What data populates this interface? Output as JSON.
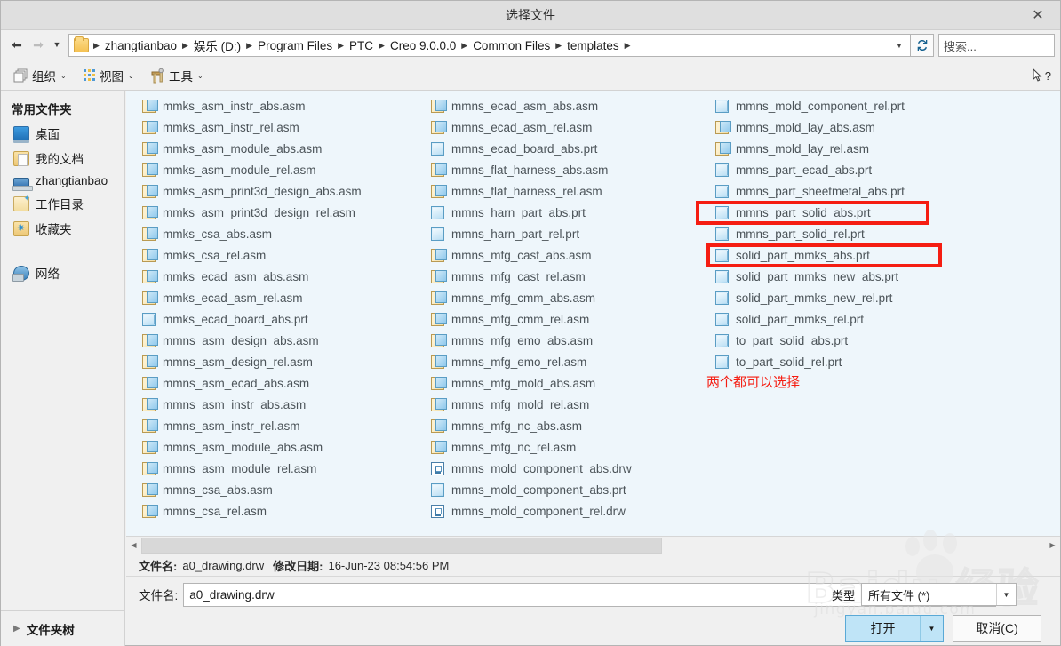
{
  "window": {
    "title": "选择文件",
    "close_label": "✕"
  },
  "addressbar": {
    "back_icon": "back-arrow-icon",
    "forward_icon": "forward-arrow-icon",
    "history_caret": "▼",
    "crumbs": [
      "zhangtianbao",
      "娱乐 (D:)",
      "Program Files",
      "PTC",
      "Creo 9.0.0.0",
      "Common Files",
      "templates"
    ],
    "separator": "▶",
    "dropdown_caret": "▼",
    "refresh_icon": "refresh-icon",
    "search_placeholder": "搜索..."
  },
  "toolbar": {
    "organize_label": "组织",
    "view_label": "视图",
    "tools_label": "工具",
    "dropdown_caret": "⌄",
    "help_icon": "help-cursor-icon"
  },
  "sidebar": {
    "heading": "常用文件夹",
    "items": [
      {
        "label": "桌面",
        "icon": "desktop-icon"
      },
      {
        "label": "我的文档",
        "icon": "documents-icon"
      },
      {
        "label": "zhangtianbao",
        "icon": "user-home-icon"
      },
      {
        "label": "工作目录",
        "icon": "working-directory-icon"
      },
      {
        "label": "收藏夹",
        "icon": "favorites-icon"
      },
      {
        "label": "网络",
        "icon": "network-icon"
      }
    ],
    "folder_tree_label": "文件夹树",
    "folder_tree_triangle": "▶"
  },
  "filelist": {
    "columns": [
      [
        {
          "name": "mmks_asm_instr_abs.asm",
          "type": "asm"
        },
        {
          "name": "mmks_asm_instr_rel.asm",
          "type": "asm"
        },
        {
          "name": "mmks_asm_module_abs.asm",
          "type": "asm"
        },
        {
          "name": "mmks_asm_module_rel.asm",
          "type": "asm"
        },
        {
          "name": "mmks_asm_print3d_design_abs.asm",
          "type": "asm"
        },
        {
          "name": "mmks_asm_print3d_design_rel.asm",
          "type": "asm"
        },
        {
          "name": "mmks_csa_abs.asm",
          "type": "asm"
        },
        {
          "name": "mmks_csa_rel.asm",
          "type": "asm"
        },
        {
          "name": "mmks_ecad_asm_abs.asm",
          "type": "asm"
        },
        {
          "name": "mmks_ecad_asm_rel.asm",
          "type": "asm"
        },
        {
          "name": "mmks_ecad_board_abs.prt",
          "type": "prt"
        },
        {
          "name": "mmns_asm_design_abs.asm",
          "type": "asm"
        },
        {
          "name": "mmns_asm_design_rel.asm",
          "type": "asm"
        },
        {
          "name": "mmns_asm_ecad_abs.asm",
          "type": "asm"
        },
        {
          "name": "mmns_asm_instr_abs.asm",
          "type": "asm"
        },
        {
          "name": "mmns_asm_instr_rel.asm",
          "type": "asm"
        },
        {
          "name": "mmns_asm_module_abs.asm",
          "type": "asm"
        },
        {
          "name": "mmns_asm_module_rel.asm",
          "type": "asm"
        },
        {
          "name": "mmns_csa_abs.asm",
          "type": "asm"
        },
        {
          "name": "mmns_csa_rel.asm",
          "type": "asm"
        }
      ],
      [
        {
          "name": "mmns_ecad_asm_abs.asm",
          "type": "asm"
        },
        {
          "name": "mmns_ecad_asm_rel.asm",
          "type": "asm"
        },
        {
          "name": "mmns_ecad_board_abs.prt",
          "type": "prt"
        },
        {
          "name": "mmns_flat_harness_abs.asm",
          "type": "asm"
        },
        {
          "name": "mmns_flat_harness_rel.asm",
          "type": "asm"
        },
        {
          "name": "mmns_harn_part_abs.prt",
          "type": "prt"
        },
        {
          "name": "mmns_harn_part_rel.prt",
          "type": "prt"
        },
        {
          "name": "mmns_mfg_cast_abs.asm",
          "type": "asm"
        },
        {
          "name": "mmns_mfg_cast_rel.asm",
          "type": "asm"
        },
        {
          "name": "mmns_mfg_cmm_abs.asm",
          "type": "asm"
        },
        {
          "name": "mmns_mfg_cmm_rel.asm",
          "type": "asm"
        },
        {
          "name": "mmns_mfg_emo_abs.asm",
          "type": "asm"
        },
        {
          "name": "mmns_mfg_emo_rel.asm",
          "type": "asm"
        },
        {
          "name": "mmns_mfg_mold_abs.asm",
          "type": "asm"
        },
        {
          "name": "mmns_mfg_mold_rel.asm",
          "type": "asm"
        },
        {
          "name": "mmns_mfg_nc_abs.asm",
          "type": "asm"
        },
        {
          "name": "mmns_mfg_nc_rel.asm",
          "type": "asm"
        },
        {
          "name": "mmns_mold_component_abs.drw",
          "type": "drw"
        },
        {
          "name": "mmns_mold_component_abs.prt",
          "type": "prt"
        },
        {
          "name": "mmns_mold_component_rel.drw",
          "type": "drw"
        }
      ],
      [
        {
          "name": "mmns_mold_component_rel.prt",
          "type": "prt"
        },
        {
          "name": "mmns_mold_lay_abs.asm",
          "type": "asm"
        },
        {
          "name": "mmns_mold_lay_rel.asm",
          "type": "asm"
        },
        {
          "name": "mmns_part_ecad_abs.prt",
          "type": "prt"
        },
        {
          "name": "mmns_part_sheetmetal_abs.prt",
          "type": "prt"
        },
        {
          "name": "mmns_part_solid_abs.prt",
          "type": "prt"
        },
        {
          "name": "mmns_part_solid_rel.prt",
          "type": "prt"
        },
        {
          "name": "solid_part_mmks_abs.prt",
          "type": "prt"
        },
        {
          "name": "solid_part_mmks_new_abs.prt",
          "type": "prt"
        },
        {
          "name": "solid_part_mmks_new_rel.prt",
          "type": "prt"
        },
        {
          "name": "solid_part_mmks_rel.prt",
          "type": "prt"
        },
        {
          "name": "to_part_solid_abs.prt",
          "type": "prt"
        },
        {
          "name": "to_part_solid_rel.prt",
          "type": "prt"
        }
      ]
    ]
  },
  "annotations": {
    "highlight_color": "#f51d12",
    "note_text": "两个都可以选择",
    "boxes": [
      {
        "target": "mmns_part_solid_abs.prt"
      },
      {
        "target": "solid_part_mmks_abs.prt"
      }
    ]
  },
  "status": {
    "filename_label": "文件名:",
    "filename_value": "a0_drawing.drw",
    "modified_label": "修改日期:",
    "modified_value": "16-Jun-23 08:54:56 PM"
  },
  "filename_field": {
    "label": "文件名:",
    "value": "a0_drawing.drw"
  },
  "filetype": {
    "label": "类型",
    "value": "所有文件 (*)",
    "caret": "▼"
  },
  "buttons": {
    "open_label": "打开",
    "open_caret": "▼",
    "cancel_label": "取消(",
    "cancel_accel": "C",
    "cancel_suffix": ")"
  },
  "scrollbar": {
    "left_arrow": "◀",
    "right_arrow": "▶"
  },
  "watermark": {
    "brand": "Baidu",
    "brand_cn": "经验",
    "url": "jingyan.baidu.com"
  }
}
